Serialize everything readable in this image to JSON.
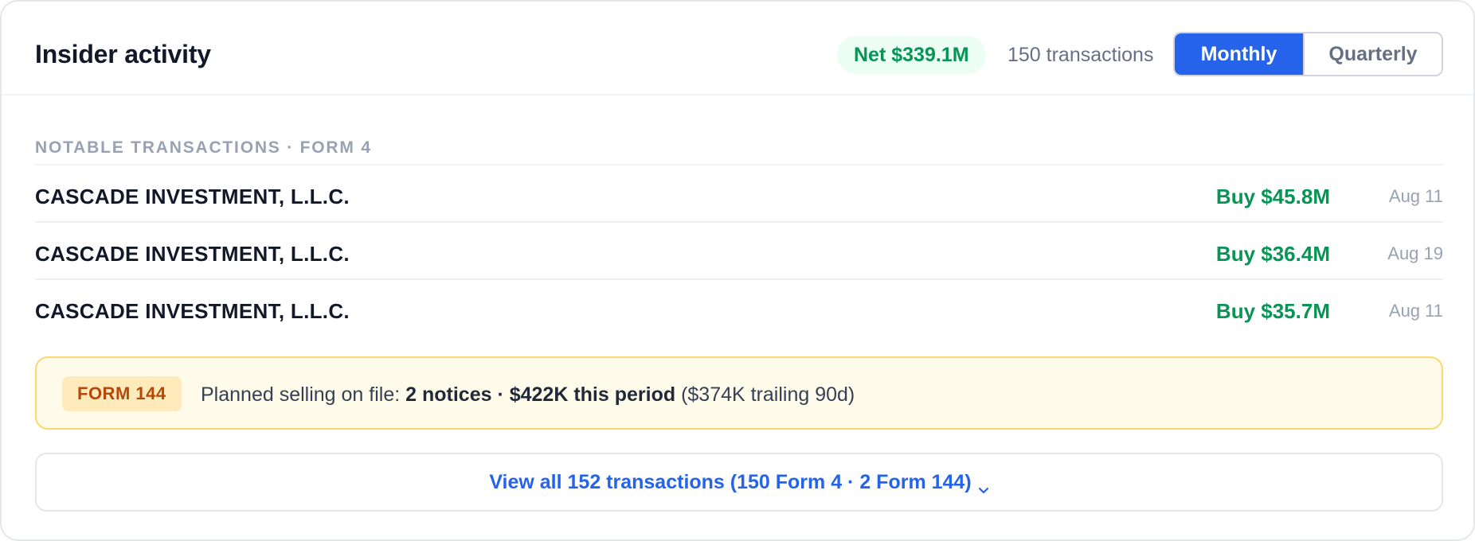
{
  "header": {
    "title": "Insider activity",
    "net_badge": "Net $339.1M",
    "transaction_count": "150 transactions",
    "period_options": [
      "Monthly",
      "Quarterly"
    ],
    "selected_period": "Monthly"
  },
  "notable": {
    "section_label": "NOTABLE TRANSACTIONS · FORM 4",
    "rows": [
      {
        "name": "CASCADE INVESTMENT, L.L.C.",
        "amount": "Buy $45.8M",
        "date": "Aug 11"
      },
      {
        "name": "CASCADE INVESTMENT, L.L.C.",
        "amount": "Buy $36.4M",
        "date": "Aug 19"
      },
      {
        "name": "CASCADE INVESTMENT, L.L.C.",
        "amount": "Buy $35.7M",
        "date": "Aug 11"
      }
    ]
  },
  "form144": {
    "badge": "FORM 144",
    "prefix": "Planned selling on file: ",
    "bold": "2 notices · $422K this period",
    "suffix": " ($374K trailing 90d)"
  },
  "view_all": {
    "label": "View all 152 transactions (150 Form 4 · 2 Form 144)",
    "icon": "chevron-down-icon"
  },
  "colors": {
    "accent_blue": "#2563eb",
    "buy_green": "#079455",
    "warning_bg": "#fffbeb",
    "warning_text": "#b54708"
  }
}
